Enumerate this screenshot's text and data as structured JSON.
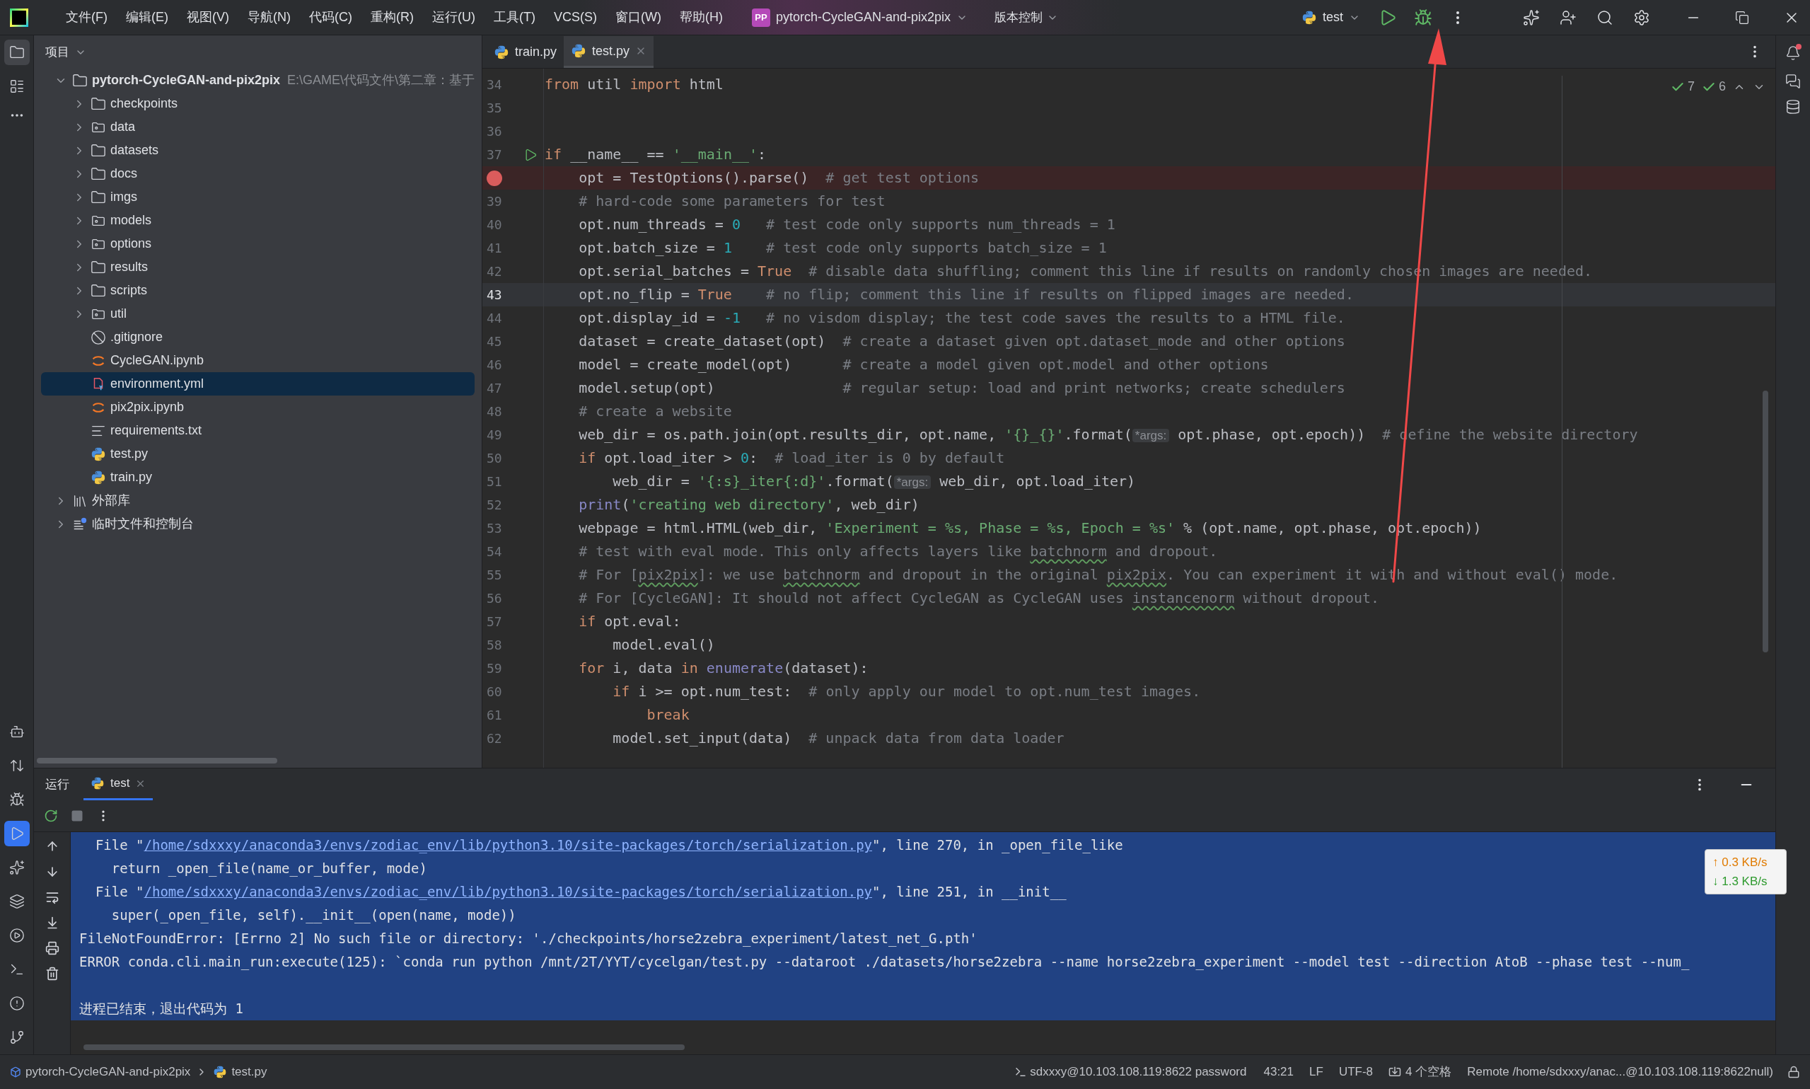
{
  "title_bar": {
    "menus": [
      "文件(F)",
      "编辑(E)",
      "视图(V)",
      "导航(N)",
      "代码(C)",
      "重构(R)",
      "运行(U)",
      "工具(T)",
      "VCS(S)",
      "窗口(W)",
      "帮助(H)"
    ],
    "project": {
      "badge": "PP",
      "name": "pytorch-CycleGAN-and-pix2pix"
    },
    "vcs_menu": "版本控制",
    "run_config": "test"
  },
  "left_toolbar": {
    "top": [
      {
        "selected": true
      },
      {
        "selected": false
      }
    ],
    "bottom": [
      {
        "selected": false
      },
      {
        "selected": false
      },
      {
        "selected": false
      },
      {
        "selected": true
      },
      {
        "selected": false
      },
      {
        "selected": false
      },
      {
        "selected": false
      },
      {
        "selected": false
      },
      {
        "selected": false
      },
      {
        "selected": false
      }
    ]
  },
  "project_panel": {
    "title": "项目",
    "tree": [
      {
        "kind": "project",
        "name": "pytorch-CycleGAN-and-pix2pix",
        "path": "E:\\GAME\\代码文件\\第二章：基于",
        "expanded": true,
        "selected": false,
        "children": [
          {
            "kind": "folder",
            "name": "checkpoints",
            "expanded": false,
            "selected": false
          },
          {
            "kind": "package",
            "name": "data",
            "expanded": false,
            "selected": false
          },
          {
            "kind": "folder",
            "name": "datasets",
            "expanded": false,
            "selected": false
          },
          {
            "kind": "folder",
            "name": "docs",
            "expanded": false,
            "selected": false
          },
          {
            "kind": "folder",
            "name": "imgs",
            "expanded": false,
            "selected": false
          },
          {
            "kind": "package",
            "name": "models",
            "expanded": false,
            "selected": false
          },
          {
            "kind": "package",
            "name": "options",
            "expanded": false,
            "selected": false
          },
          {
            "kind": "folder",
            "name": "results",
            "expanded": false,
            "selected": false
          },
          {
            "kind": "folder",
            "name": "scripts",
            "expanded": false,
            "selected": false
          },
          {
            "kind": "package",
            "name": "util",
            "expanded": false,
            "selected": false
          },
          {
            "kind": "ignore",
            "name": ".gitignore",
            "selected": false
          },
          {
            "kind": "notebook",
            "name": "CycleGAN.ipynb",
            "selected": false
          },
          {
            "kind": "yaml",
            "name": "environment.yml",
            "selected": true
          },
          {
            "kind": "notebook",
            "name": "pix2pix.ipynb",
            "selected": false
          },
          {
            "kind": "text",
            "name": "requirements.txt",
            "selected": false
          },
          {
            "kind": "python",
            "name": "test.py",
            "selected": false
          },
          {
            "kind": "python",
            "name": "train.py",
            "selected": false
          }
        ]
      },
      {
        "kind": "library",
        "name": "外部库",
        "expanded": false,
        "selected": false
      },
      {
        "kind": "scratch",
        "name": "临时文件和控制台",
        "expanded": false,
        "selected": false
      }
    ]
  },
  "editor": {
    "tabs": [
      {
        "label": "train.py",
        "selected": false
      },
      {
        "label": "test.py",
        "selected": true
      }
    ],
    "inspections": [
      "7",
      "6"
    ],
    "lines": [
      {
        "no": "34",
        "kind": "code",
        "breakpoint": false,
        "current": false,
        "tokens": [
          {
            "kind": "keyword",
            "t": "from"
          },
          {
            "kind": "plain",
            "t": " util "
          },
          {
            "kind": "keyword",
            "t": "import"
          },
          {
            "kind": "plain",
            "t": " html"
          }
        ]
      },
      {
        "no": "35",
        "kind": "code",
        "breakpoint": false,
        "current": false
      },
      {
        "no": "36",
        "kind": "code",
        "breakpoint": false,
        "current": false
      },
      {
        "no": "37",
        "kind": "runnable",
        "breakpoint": false,
        "current": false,
        "tokens": [
          {
            "kind": "keyword",
            "t": "if"
          },
          {
            "kind": "plain",
            "t": " __name__ == "
          },
          {
            "kind": "string",
            "t": "'__main__'"
          },
          {
            "kind": "plain",
            "t": ":"
          }
        ]
      },
      {
        "kind": "code",
        "breakpoint": true,
        "current": false,
        "tokens": [
          {
            "kind": "plain",
            "t": "    opt = TestOptions().parse()  "
          },
          {
            "kind": "comment",
            "t": "# get test options"
          }
        ]
      },
      {
        "no": "39",
        "kind": "code",
        "breakpoint": false,
        "current": false,
        "tokens": [
          {
            "kind": "comment",
            "t": "    # hard-code some parameters for test"
          }
        ]
      },
      {
        "no": "40",
        "kind": "code",
        "breakpoint": false,
        "current": false,
        "tokens": [
          {
            "kind": "plain",
            "t": "    opt.num_threads = "
          },
          {
            "kind": "number",
            "t": "0"
          },
          {
            "kind": "comment",
            "t": "   # test code only supports num_threads = 1"
          }
        ]
      },
      {
        "no": "41",
        "kind": "code",
        "breakpoint": false,
        "current": false,
        "tokens": [
          {
            "kind": "plain",
            "t": "    opt.batch_size = "
          },
          {
            "kind": "number",
            "t": "1"
          },
          {
            "kind": "comment",
            "t": "    # test code only supports batch_size = 1"
          }
        ]
      },
      {
        "no": "42",
        "kind": "code",
        "breakpoint": false,
        "current": false,
        "tokens": [
          {
            "kind": "plain",
            "t": "    opt.serial_batches = "
          },
          {
            "kind": "keyword",
            "t": "True"
          },
          {
            "kind": "comment",
            "t": "  # disable data shuffling; comment this line if results on randomly chosen images are needed."
          }
        ]
      },
      {
        "no": "43",
        "kind": "code",
        "breakpoint": false,
        "current": true,
        "tokens": [
          {
            "kind": "plain",
            "t": "    opt.no_flip = "
          },
          {
            "kind": "keyword",
            "t": "True"
          },
          {
            "kind": "comment",
            "t": "    # no flip; comment this line if results on flipped images are needed."
          }
        ]
      },
      {
        "no": "44",
        "kind": "code",
        "breakpoint": false,
        "current": false,
        "tokens": [
          {
            "kind": "plain",
            "t": "    opt.display_id = "
          },
          {
            "kind": "number",
            "t": "-1"
          },
          {
            "kind": "comment",
            "t": "   # no visdom display; the test code saves the results to a HTML file."
          }
        ]
      },
      {
        "no": "45",
        "kind": "code",
        "breakpoint": false,
        "current": false,
        "tokens": [
          {
            "kind": "plain",
            "t": "    dataset = create_dataset(opt)  "
          },
          {
            "kind": "comment",
            "t": "# create a dataset given opt.dataset_mode and other options"
          }
        ]
      },
      {
        "no": "46",
        "kind": "code",
        "breakpoint": false,
        "current": false,
        "tokens": [
          {
            "kind": "plain",
            "t": "    model = create_model(opt)      "
          },
          {
            "kind": "comment",
            "t": "# create a model given opt.model and other options"
          }
        ]
      },
      {
        "no": "47",
        "kind": "code",
        "breakpoint": false,
        "current": false,
        "tokens": [
          {
            "kind": "plain",
            "t": "    model.setup(opt)               "
          },
          {
            "kind": "comment",
            "t": "# regular setup: load and print networks; create schedulers"
          }
        ]
      },
      {
        "no": "48",
        "kind": "code",
        "breakpoint": false,
        "current": false,
        "tokens": [
          {
            "kind": "comment",
            "t": "    # create a website"
          }
        ]
      },
      {
        "no": "49",
        "kind": "code",
        "breakpoint": false,
        "current": false,
        "tokens": [
          {
            "kind": "plain",
            "t": "    web_dir = os.path.join(opt.results_dir, opt.name, "
          },
          {
            "kind": "string",
            "t": "'{}_{}'"
          },
          {
            "kind": "plain",
            "t": ".format("
          },
          {
            "kind": "hint",
            "t": "*args:"
          },
          {
            "kind": "plain",
            "t": " opt.phase, opt.epoch))  "
          },
          {
            "kind": "comment",
            "t": "# define the website directory"
          }
        ]
      },
      {
        "no": "50",
        "kind": "code",
        "breakpoint": false,
        "current": false,
        "tokens": [
          {
            "kind": "keyword",
            "t": "    if"
          },
          {
            "kind": "plain",
            "t": " opt.load_iter > "
          },
          {
            "kind": "number",
            "t": "0"
          },
          {
            "kind": "plain",
            "t": ":  "
          },
          {
            "kind": "comment",
            "t": "# load_iter is 0 by default"
          }
        ]
      },
      {
        "no": "51",
        "kind": "code",
        "breakpoint": false,
        "current": false,
        "tokens": [
          {
            "kind": "plain",
            "t": "        web_dir = "
          },
          {
            "kind": "string",
            "t": "'{:s}_iter{:d}'"
          },
          {
            "kind": "plain",
            "t": ".format("
          },
          {
            "kind": "hint",
            "t": "*args:"
          },
          {
            "kind": "plain",
            "t": " web_dir, opt.load_iter)"
          }
        ]
      },
      {
        "no": "52",
        "kind": "code",
        "breakpoint": false,
        "current": false,
        "tokens": [
          {
            "kind": "builtin",
            "t": "    print"
          },
          {
            "kind": "plain",
            "t": "("
          },
          {
            "kind": "string",
            "t": "'creating web directory'"
          },
          {
            "kind": "plain",
            "t": ", web_dir)"
          }
        ]
      },
      {
        "no": "53",
        "kind": "code",
        "breakpoint": false,
        "current": false,
        "tokens": [
          {
            "kind": "plain",
            "t": "    webpage = html.HTML(web_dir, "
          },
          {
            "kind": "string",
            "t": "'Experiment = %s, Phase = %s, Epoch = %s'"
          },
          {
            "kind": "plain",
            "t": " % (opt.name, opt.phase, opt.epoch))"
          }
        ]
      },
      {
        "no": "54",
        "kind": "code",
        "breakpoint": false,
        "current": false,
        "tokens": [
          {
            "kind": "comment",
            "t": "    # test with eval mode. This only affects layers like "
          },
          {
            "kind": "typo",
            "t": "batchnorm"
          },
          {
            "kind": "comment",
            "t": " and dropout."
          }
        ]
      },
      {
        "no": "55",
        "kind": "code",
        "breakpoint": false,
        "current": false,
        "tokens": [
          {
            "kind": "comment",
            "t": "    # For ["
          },
          {
            "kind": "typo",
            "t": "pix2pix"
          },
          {
            "kind": "comment",
            "t": "]: we use "
          },
          {
            "kind": "typo",
            "t": "batchnorm"
          },
          {
            "kind": "comment",
            "t": " and dropout in the original "
          },
          {
            "kind": "typo",
            "t": "pix2pix"
          },
          {
            "kind": "comment",
            "t": ". You can experiment it with and without eval() mode."
          }
        ]
      },
      {
        "no": "56",
        "kind": "code",
        "breakpoint": false,
        "current": false,
        "tokens": [
          {
            "kind": "comment",
            "t": "    # For [CycleGAN]: It should not affect CycleGAN as CycleGAN uses "
          },
          {
            "kind": "typo",
            "t": "instancenorm"
          },
          {
            "kind": "comment",
            "t": " without dropout."
          }
        ]
      },
      {
        "no": "57",
        "kind": "code",
        "breakpoint": false,
        "current": false,
        "tokens": [
          {
            "kind": "keyword",
            "t": "    if"
          },
          {
            "kind": "plain",
            "t": " opt.eval:"
          }
        ]
      },
      {
        "no": "58",
        "kind": "code",
        "breakpoint": false,
        "current": false,
        "tokens": [
          {
            "kind": "plain",
            "t": "        model.eval()"
          }
        ]
      },
      {
        "no": "59",
        "kind": "code",
        "breakpoint": false,
        "current": false,
        "tokens": [
          {
            "kind": "keyword",
            "t": "    for"
          },
          {
            "kind": "plain",
            "t": " i, data "
          },
          {
            "kind": "keyword",
            "t": "in"
          },
          {
            "kind": "builtin",
            "t": " enumerate"
          },
          {
            "kind": "plain",
            "t": "(dataset):"
          }
        ]
      },
      {
        "no": "60",
        "kind": "code",
        "breakpoint": false,
        "current": false,
        "tokens": [
          {
            "kind": "keyword",
            "t": "        if"
          },
          {
            "kind": "plain",
            "t": " i >= opt.num_test:  "
          },
          {
            "kind": "comment",
            "t": "# only apply our model to opt.num_test images."
          }
        ]
      },
      {
        "no": "61",
        "kind": "code",
        "breakpoint": false,
        "current": false,
        "tokens": [
          {
            "kind": "keyword",
            "t": "            break"
          }
        ]
      },
      {
        "no": "62",
        "kind": "code",
        "breakpoint": false,
        "current": false,
        "tokens": [
          {
            "kind": "plain",
            "t": "        model.set_input(data)  "
          },
          {
            "kind": "comment",
            "t": "# unpack data from data loader"
          }
        ]
      }
    ]
  },
  "run_panel": {
    "title": "运行",
    "tabs": [
      {
        "label": "test",
        "selected": true
      }
    ],
    "console": [
      {
        "kind": "output",
        "tokens": [
          {
            "kind": "plain",
            "t": "  File \""
          },
          {
            "kind": "link",
            "t": "/home/sdxxxy/anaconda3/envs/zodiac_env/lib/python3.10/site-packages/torch/serialization.py"
          },
          {
            "kind": "plain",
            "t": "\", line 270, in _open_file_like"
          }
        ]
      },
      {
        "kind": "output",
        "tokens": [
          {
            "kind": "plain",
            "t": "    return _open_file(name_or_buffer, mode)"
          }
        ]
      },
      {
        "kind": "output",
        "tokens": [
          {
            "kind": "plain",
            "t": "  File \""
          },
          {
            "kind": "link",
            "t": "/home/sdxxxy/anaconda3/envs/zodiac_env/lib/python3.10/site-packages/torch/serialization.py"
          },
          {
            "kind": "plain",
            "t": "\", line 251, in __init__"
          }
        ]
      },
      {
        "kind": "output",
        "tokens": [
          {
            "kind": "plain",
            "t": "    super(_open_file, self).__init__(open(name, mode))"
          }
        ]
      },
      {
        "kind": "output",
        "tokens": [
          {
            "kind": "plain",
            "t": "FileNotFoundError: [Errno 2] No such file or directory: './checkpoints/horse2zebra_experiment/latest_net_G.pth'"
          }
        ]
      },
      {
        "kind": "output",
        "tokens": [
          {
            "kind": "plain",
            "t": "ERROR conda.cli.main_run:execute(125): `conda run python /mnt/2T/YYT/cycelgan/test.py --dataroot ./datasets/horse2zebra --name horse2zebra_experiment --model test --direction AtoB --phase test --num_"
          }
        ]
      },
      {
        "kind": "exit_message",
        "tokens": [
          {
            "kind": "plain",
            "t": "进程已结束，退出代码为 1"
          }
        ]
      }
    ]
  },
  "network_monitor": {
    "upload": "↑ 0.3 KB/s",
    "download": "↓ 1.3 KB/s"
  },
  "status_bar": {
    "breadcrumbs": [
      "pytorch-CycleGAN-and-pix2pix",
      "test.py"
    ],
    "connection": "sdxxxy@10.103.108.119:8622 password",
    "position": "43:21",
    "line_ending": "LF",
    "encoding": "UTF-8",
    "indent": "4 个空格",
    "interpreter": "Remote /home/sdxxxy/anac...@10.103.108.119:8622null)"
  }
}
